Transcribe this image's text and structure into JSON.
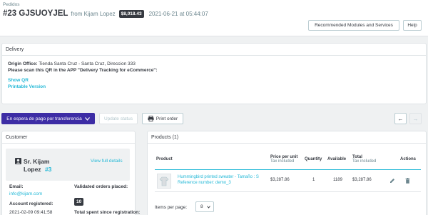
{
  "header": {
    "breadcrumb": "Pedidos",
    "order_title": "#23 GJSUOYJEL",
    "from": "from Kijam Lopez",
    "total": "$8,018.43",
    "date": "2021-06-21",
    "at": "at",
    "time": "05:44:07",
    "recommended_modules": "Recommended Modules and Services",
    "help": "Help"
  },
  "delivery": {
    "title": "Delivery",
    "origin_label": "Origin Office:",
    "origin_value": "Tienda Santa Cruz - Santa Cruz, Direccion 333",
    "scan_text": "Please scan this QR in the APP \"Delivery Tracking for eCommerce\":",
    "show_qr": "Show QR",
    "printable": "Printable Version"
  },
  "toolbar": {
    "status": "En espera de pago por transferencia",
    "update_status": "Update status",
    "print_order": "Print order"
  },
  "customer": {
    "title": "Customer",
    "name_line1": "Sr. Kijam",
    "name_line2": "Lopez",
    "id": "#3",
    "view_details": "View full details",
    "email_label": "Email:",
    "email": "info@kijam.com",
    "validated_label": "Validated orders placed:",
    "validated_count": "10",
    "account_label": "Account registered:",
    "account_date": "2021-02-09 09:41:58",
    "total_label": "Total spent since registration:"
  },
  "products": {
    "title": "Products (1)",
    "columns": {
      "product": "Product",
      "price": "Price per unit",
      "price_sub": "Tax included",
      "quantity": "Quantity",
      "available": "Available",
      "total": "Total",
      "total_sub": "Tax included",
      "actions": "Actions"
    },
    "rows": [
      {
        "name": "Hummingbird printed sweater - Tamaño : S",
        "reference": "Reference number: demo_3",
        "price": "$3,287.86",
        "quantity": "1",
        "available": "1189",
        "total": "$3,287.86"
      }
    ],
    "items_per_page_label": "Items per page:",
    "items_per_page": "8"
  },
  "colors": {
    "accent": "#25b9d7",
    "status_purple": "#3d2da5",
    "badge_dark": "#363a41"
  }
}
